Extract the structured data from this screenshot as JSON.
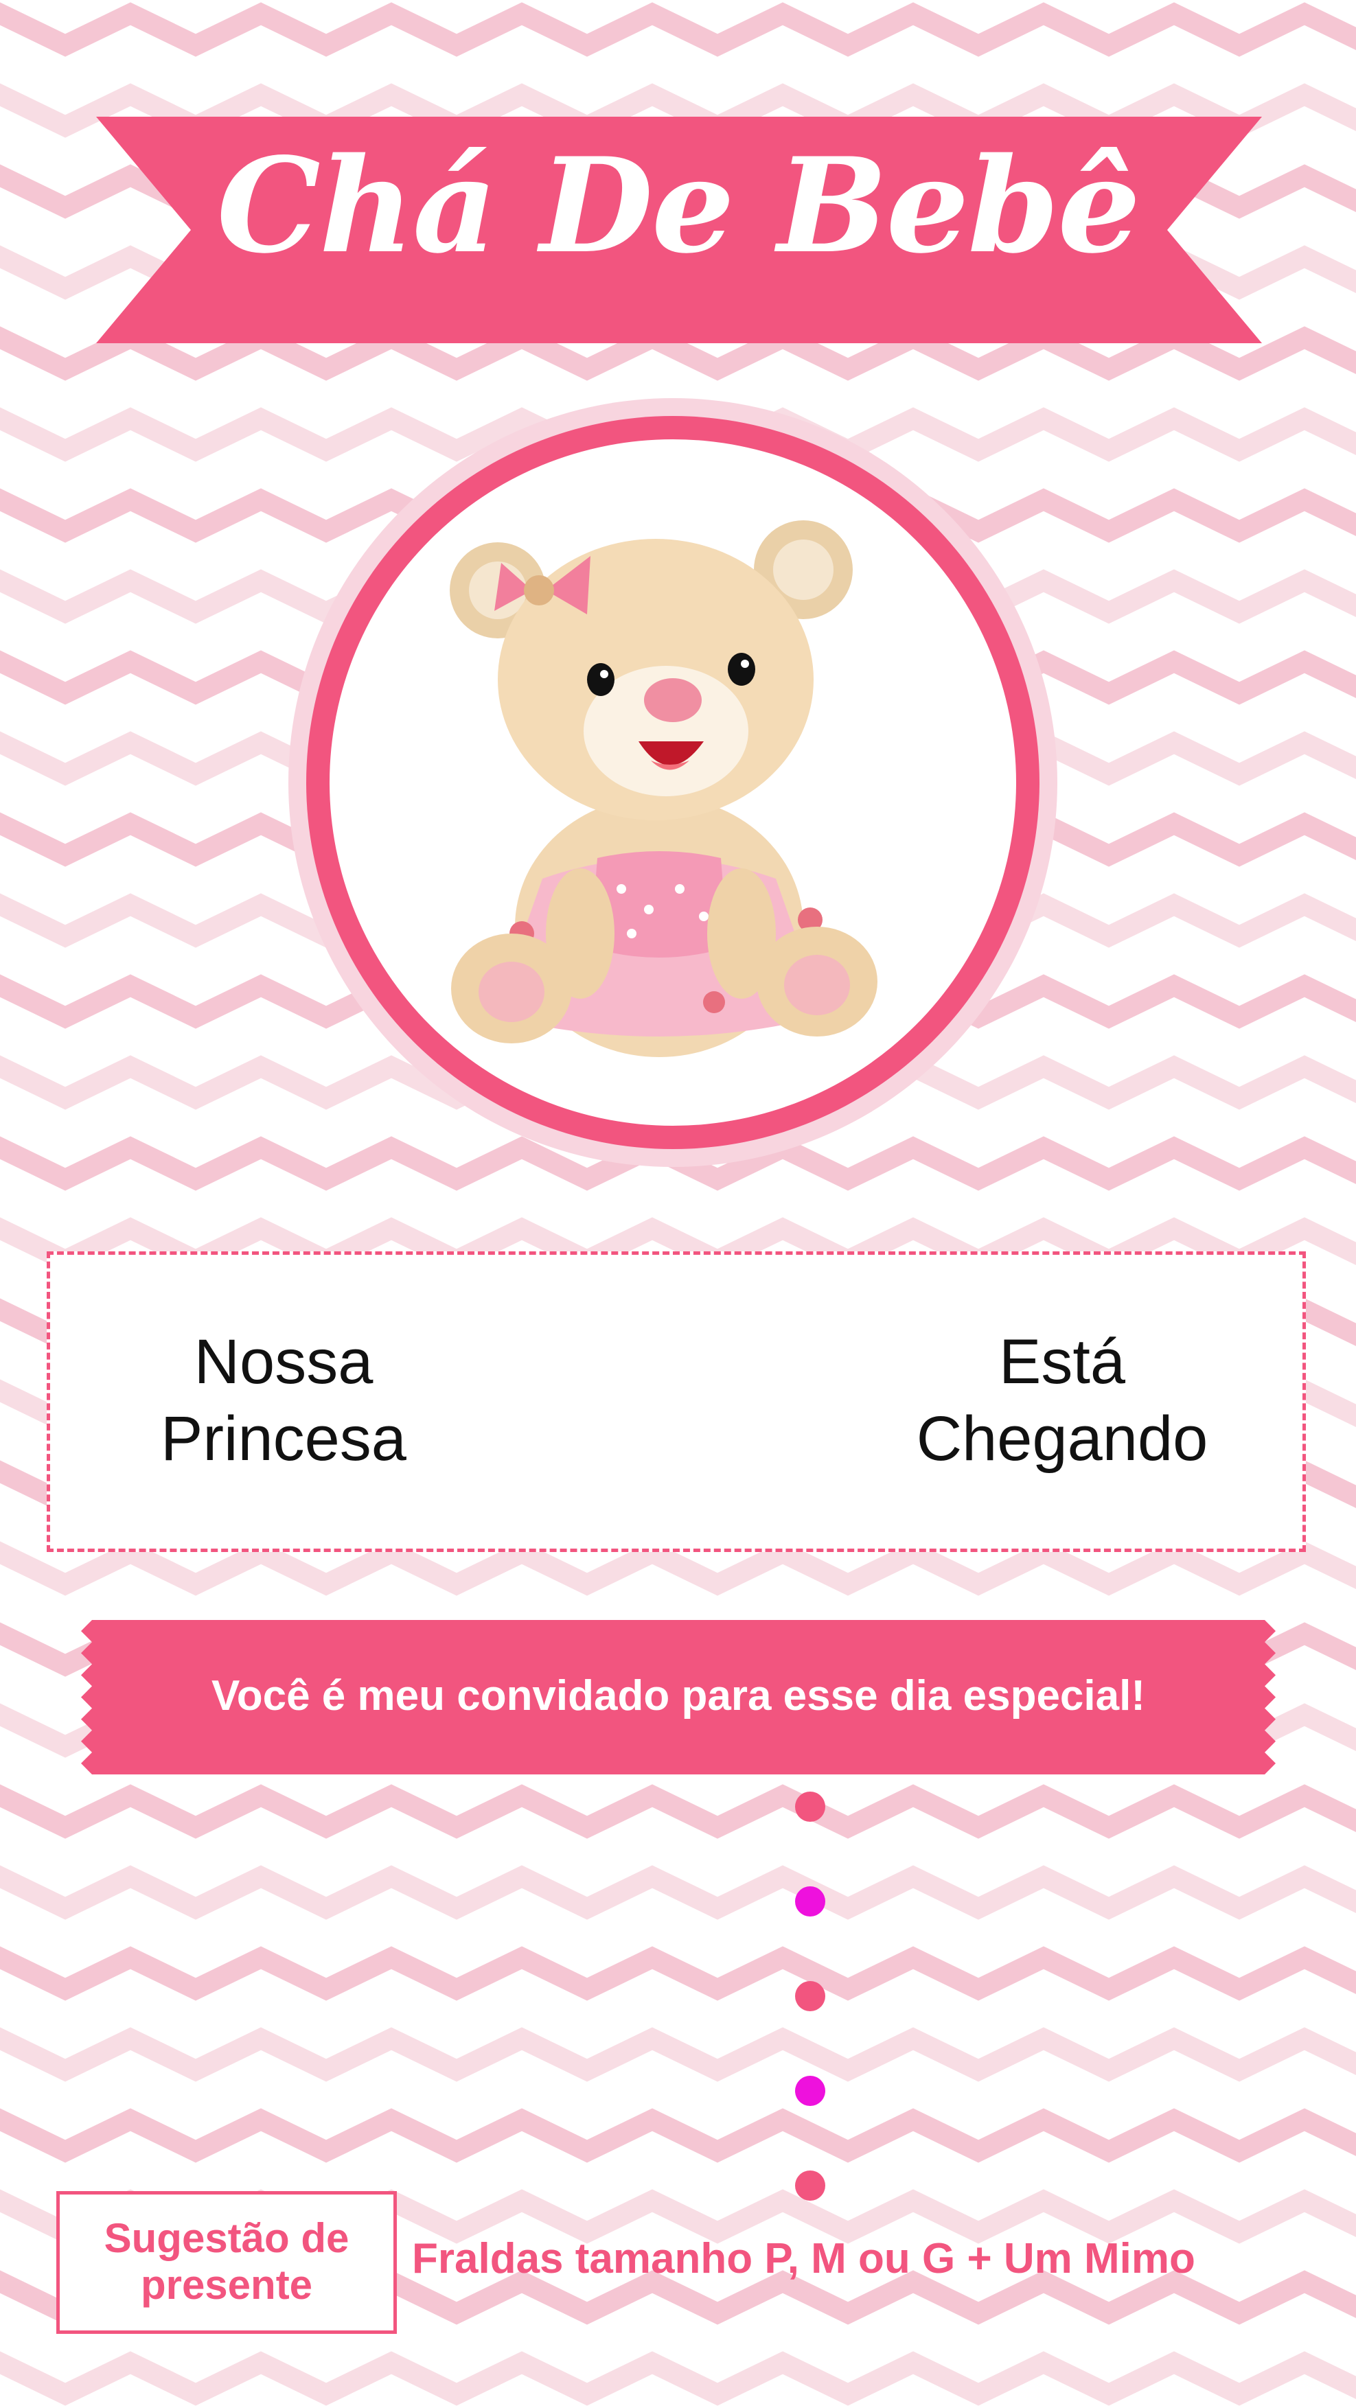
{
  "header": {
    "title": "Chá De Bebê"
  },
  "illustration": {
    "icon": "teddy-bear-girl-icon"
  },
  "message": {
    "left_lines": [
      "Nossa",
      "Princesa"
    ],
    "right_lines": [
      "Está",
      "Chegando"
    ]
  },
  "invitation": {
    "text": "Você é meu convidado para esse dia especial!"
  },
  "gift": {
    "label_lines": [
      "Sugestão de",
      "presente"
    ],
    "text": "Fraldas tamanho P, M ou G + Um Mimo"
  },
  "colors": {
    "accent": "#f2557f",
    "chevron_pink": "#f5c6d3",
    "chevron_light": "#f8dde4",
    "dot_pink": "#f2557f",
    "dot_magenta": "#ee11dd",
    "bear_fur": "#f4dbb6"
  }
}
